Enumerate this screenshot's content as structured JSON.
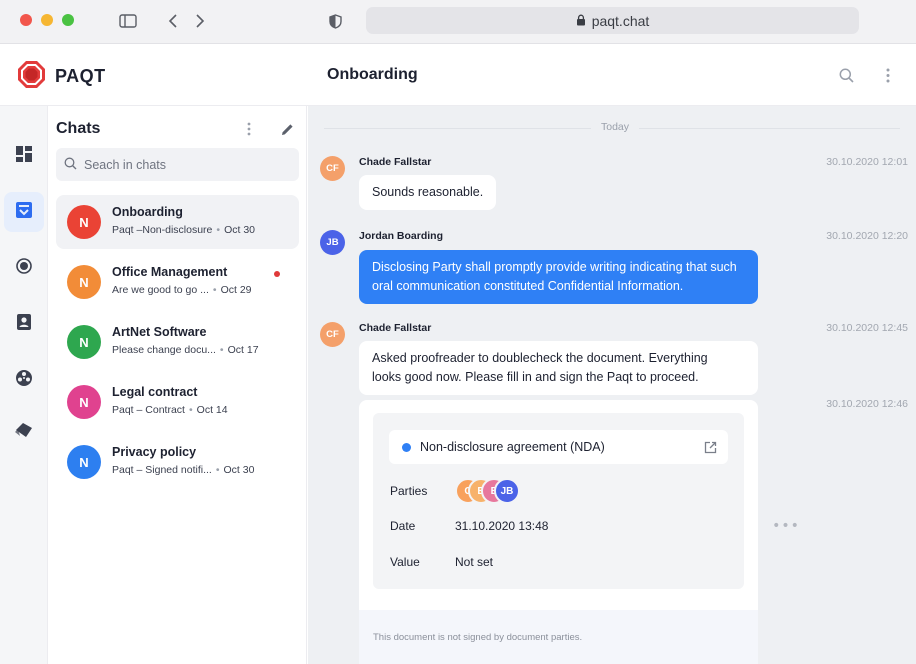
{
  "browser": {
    "url": "paqt.chat",
    "icons": {
      "sidebar": "sidebar-icon",
      "back": "chevron-left-icon",
      "forward": "chevron-right-icon",
      "shield": "shield-icon",
      "lock": "lock-icon"
    }
  },
  "header": {
    "brand": "PAQT",
    "conversation_title": "Onboarding",
    "icons": {
      "logo": "paqt-logo-icon",
      "search": "search-icon",
      "more": "more-vertical-icon"
    }
  },
  "rail": {
    "items": [
      {
        "icon": "dashboard-icon",
        "active": false
      },
      {
        "icon": "inbox-icon",
        "active": true
      },
      {
        "icon": "target-icon",
        "active": false
      },
      {
        "icon": "contacts-icon",
        "active": false
      },
      {
        "icon": "reel-icon",
        "active": false
      },
      {
        "icon": "documents-icon",
        "active": false
      }
    ]
  },
  "chats": {
    "title": "Chats",
    "search_placeholder": "Seach in chats",
    "items": [
      {
        "initial": "N",
        "color": "#ea4335",
        "name": "Onboarding",
        "preview": "Paqt –Non-disclosure",
        "date": "Oct 30",
        "selected": true,
        "unread": false
      },
      {
        "initial": "N",
        "color": "#f28c38",
        "name": "Office Management",
        "preview": "Are we good to go ...",
        "date": "Oct 29",
        "selected": false,
        "unread": true
      },
      {
        "initial": "N",
        "color": "#2ea74f",
        "name": "ArtNet Software",
        "preview": "Please change docu...",
        "date": "Oct 17",
        "selected": false,
        "unread": false
      },
      {
        "initial": "N",
        "color": "#e0428f",
        "name": "Legal contract",
        "preview": "Paqt – Contract",
        "date": "Oct 14",
        "selected": false,
        "unread": false
      },
      {
        "initial": "N",
        "color": "#2d7ff0",
        "name": "Privacy policy",
        "preview": "Paqt – Signed notifi...",
        "date": "Oct 30",
        "selected": false,
        "unread": false
      }
    ]
  },
  "conversation": {
    "day_label": "Today",
    "messages": [
      {
        "initials": "CF",
        "color": "#f4a06a",
        "sender": "Chade Fallstar",
        "time": "30.10.2020 12:01",
        "text": "Sounds reasonable."
      },
      {
        "initials": "JB",
        "color": "#4b63e8",
        "sender": "Jordan Boarding",
        "time": "30.10.2020 12:20",
        "text_lines": [
          "Disclosing Party shall promptly provide writing indicating that such",
          "oral communication constituted Confidential Information."
        ]
      },
      {
        "initials": "CF",
        "color": "#f4a06a",
        "sender": "Chade Fallstar",
        "time": "30.10.2020 12:45",
        "text_lines": [
          "Asked proofreader to doublecheck the document. Everything",
          "looks good now. Please fill in and sign the Paqt to proceed."
        ]
      }
    ],
    "document": {
      "time": "30.10.2020 12:46",
      "title": "Non-disclosure agreement (NDA)",
      "parties_label": "Parties",
      "parties": [
        {
          "initial": "C",
          "color": "#f8a15d"
        },
        {
          "initial": "B",
          "color": "#f7b26b"
        },
        {
          "initial": "E",
          "color": "#e7789d"
        },
        {
          "initials": "JB",
          "color": "#4b63e8"
        }
      ],
      "date_label": "Date",
      "date_value": "31.10.2020 13:48",
      "value_label": "Value",
      "value_value": "Not set",
      "footer": "This document is not signed by document parties.",
      "open_icon": "external-link-icon",
      "more_icon": "more-horizontal-icon"
    }
  }
}
